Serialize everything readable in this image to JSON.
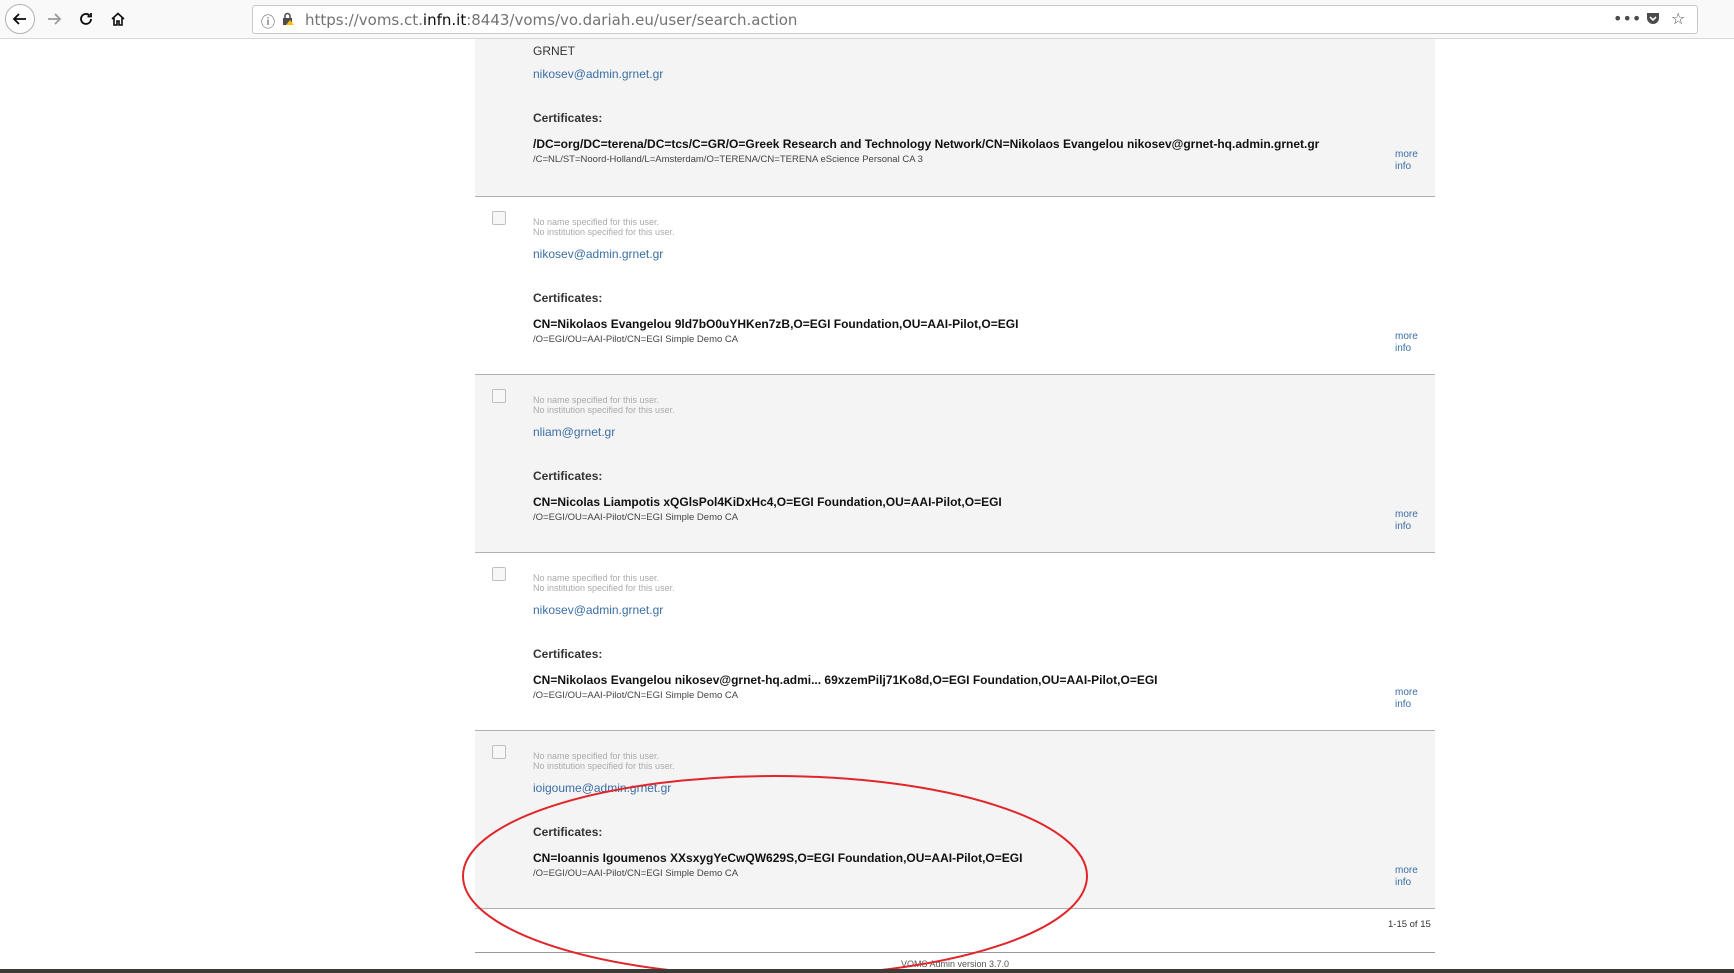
{
  "browser": {
    "url_prefix": "https://voms.ct.",
    "url_host": "infn.it",
    "url_suffix": ":8443/voms/vo.dariah.eu/user/search.action"
  },
  "top_partial": {
    "org": "GRNET",
    "email": "nikosev@admin.grnet.gr",
    "cert_label": "Certificates:",
    "dn": "/DC=org/DC=terena/DC=tcs/C=GR/O=Greek Research and Technology Network/CN=Nikolaos Evangelou nikosev@grnet-hq.admin.grnet.gr",
    "ca": "/C=NL/ST=Noord-Holland/L=Amsterdam/O=TERENA/CN=TERENA eScience Personal CA 3",
    "more": "more",
    "info": "info"
  },
  "users": [
    {
      "no_name": "No name specified for this user.",
      "no_inst": "No institution specified for this user.",
      "email": "nikosev@admin.grnet.gr",
      "cert_label": "Certificates:",
      "dn": "CN=Nikolaos Evangelou 9ld7bO0uYHKen7zB,O=EGI Foundation,OU=AAI-Pilot,O=EGI",
      "ca": "/O=EGI/OU=AAI-Pilot/CN=EGI Simple Demo CA",
      "more": "more",
      "info": "info"
    },
    {
      "no_name": "No name specified for this user.",
      "no_inst": "No institution specified for this user.",
      "email": "nliam@grnet.gr",
      "cert_label": "Certificates:",
      "dn": "CN=Nicolas Liampotis xQGlsPol4KiDxHc4,O=EGI Foundation,OU=AAI-Pilot,O=EGI",
      "ca": "/O=EGI/OU=AAI-Pilot/CN=EGI Simple Demo CA",
      "more": "more",
      "info": "info"
    },
    {
      "no_name": "No name specified for this user.",
      "no_inst": "No institution specified for this user.",
      "email": "nikosev@admin.grnet.gr",
      "cert_label": "Certificates:",
      "dn": "CN=Nikolaos Evangelou nikosev@grnet-hq.admi... 69xzemPilj71Ko8d,O=EGI Foundation,OU=AAI-Pilot,O=EGI",
      "ca": "/O=EGI/OU=AAI-Pilot/CN=EGI Simple Demo CA",
      "more": "more",
      "info": "info"
    },
    {
      "no_name": "No name specified for this user.",
      "no_inst": "No institution specified for this user.",
      "email": "ioigoume@admin.grnet.gr",
      "cert_label": "Certificates:",
      "dn": "CN=Ioannis Igoumenos XXsxygYeCwQW629S,O=EGI Foundation,OU=AAI-Pilot,O=EGI",
      "ca": "/O=EGI/OU=AAI-Pilot/CN=EGI Simple Demo CA",
      "more": "more",
      "info": "info"
    }
  ],
  "pager": "1-15 of 15",
  "footer": "VOMS Admin version 3.7.0",
  "colors": {
    "link": "#3a6ea5",
    "annotation": "#e0262b"
  }
}
